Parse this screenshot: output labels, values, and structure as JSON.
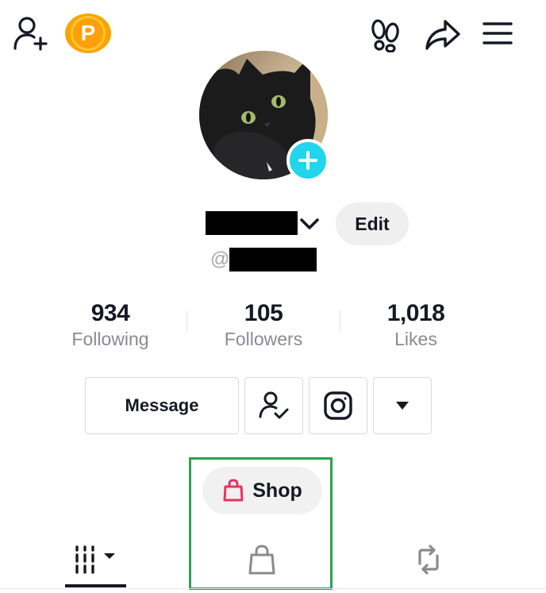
{
  "header": {
    "add_friend_icon": "person-plus-icon",
    "coin_letter": "P",
    "footprint_icon": "footprints-icon",
    "share_icon": "share-arrow-icon",
    "menu_icon": "hamburger-menu-icon"
  },
  "profile": {
    "username_redacted": true,
    "handle_prefix": "@",
    "edit_label": "Edit",
    "add_avatar_icon": "plus-icon"
  },
  "stats": [
    {
      "value": "934",
      "label": "Following"
    },
    {
      "value": "105",
      "label": "Followers"
    },
    {
      "value": "1,018",
      "label": "Likes"
    }
  ],
  "actions": {
    "message_label": "Message",
    "friends_icon": "person-check-icon",
    "instagram_icon": "instagram-icon",
    "more_icon": "triangle-down-icon"
  },
  "shop": {
    "label": "Shop",
    "icon": "shopping-bag-icon"
  },
  "tabs": {
    "videos_icon": "grid-bars-icon",
    "shop_icon": "shopping-bag-outline-icon",
    "reposts_icon": "repost-icon"
  },
  "colors": {
    "accent_cyan": "#20d5ec",
    "coin_orange": "#ff9f0a",
    "shop_pink": "#e8335c",
    "highlight_green": "#2fa152"
  }
}
